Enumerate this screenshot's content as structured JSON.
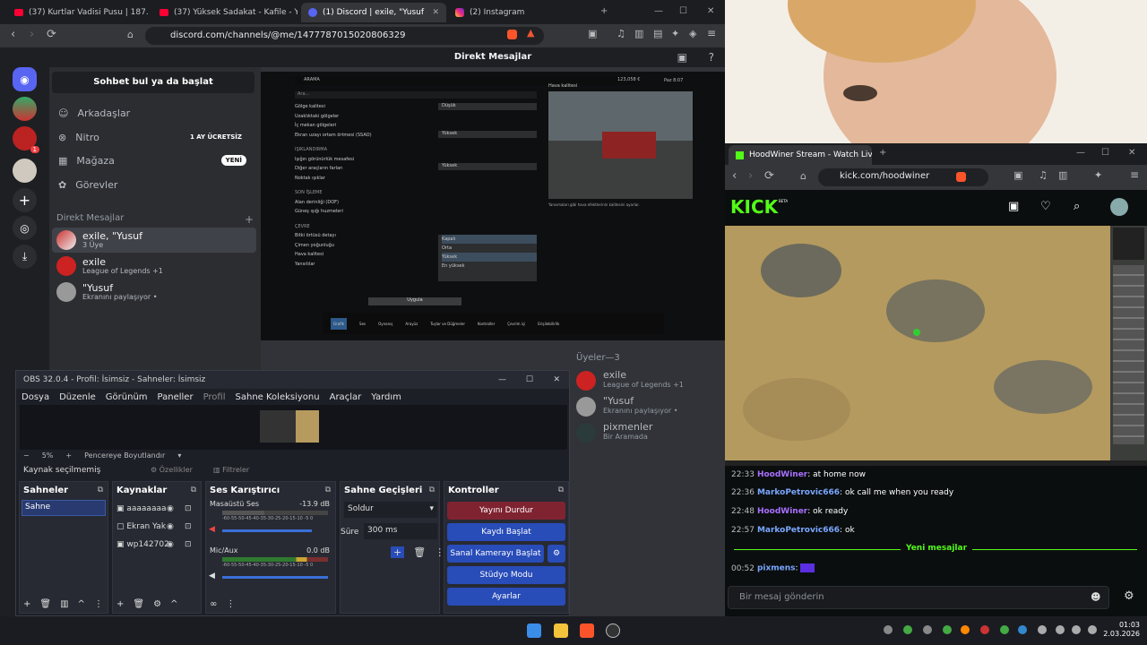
{
  "left_browser": {
    "tabs": [
      {
        "label": "(37) Kurtlar Vadisi Pusu | 187. Bölüm",
        "icon": "youtube-icon"
      },
      {
        "label": "(37) Yüksek Sadakat - Kafile - Yo",
        "icon": "youtube-icon"
      },
      {
        "label": "(1) Discord | exile, \"Yusuf",
        "icon": "discord-icon",
        "active": true
      },
      {
        "label": "(2) Instagram",
        "icon": "instagram-icon"
      }
    ],
    "url": "discord.com/channels/@me/1477787015020806329"
  },
  "discord": {
    "title": "Direkt Mesajlar",
    "search_label": "Sohbet bul ya da başlat",
    "nav": [
      {
        "label": "Arkadaşlar",
        "icon": "friends-icon"
      },
      {
        "label": "Nitro",
        "icon": "nitro-icon",
        "badge": "1 AY ÜCRETSİZ"
      },
      {
        "label": "Mağaza",
        "icon": "shop-icon",
        "badge": "YENİ"
      },
      {
        "label": "Görevler",
        "icon": "quests-icon"
      }
    ],
    "dm_header": "Direkt Mesajlar",
    "dms": [
      {
        "name": "exile, \"Yusuf",
        "sub": "3 Üye"
      },
      {
        "name": "exile",
        "sub": "League of Legends +1"
      },
      {
        "name": "\"Yusuf",
        "sub": "Ekranını paylaşıyor •"
      }
    ],
    "members_title": "Üyeler—3",
    "members": [
      {
        "name": "exile",
        "sub": "League of Legends +1"
      },
      {
        "name": "\"Yusuf",
        "sub": "Ekranını paylaşıyor •"
      },
      {
        "name": "pixmenler",
        "sub": "Bir Aramada"
      }
    ],
    "rail_badge": "1"
  },
  "game_settings": {
    "rows_a": [
      "Gölge kalitesi",
      "Uzaklıktaki gölgeler",
      "İç mekan gölgeleri",
      "Ekran uzayı ortam örtmesi (SSAO)"
    ],
    "values_a": [
      "Düşük",
      "",
      "",
      "Yüksek"
    ],
    "sec_b": "IŞIKLANDIRMA",
    "rows_b": [
      "Işığın görünürlük mesafesi",
      "Diğer araçların farları",
      "Noktalı ışıklar"
    ],
    "values_b": [
      "Yüksek",
      "",
      ""
    ],
    "sec_c": "SON İŞLEME",
    "rows_c": [
      "Alan derinliği (DOF)",
      "Güneş ışığı huzmeleri"
    ],
    "sec_d": "ÇEVRE",
    "rows_d": [
      "Bitki örtüsü detayı",
      "Çimen yoğunluğu",
      "Hava kalitesi",
      "Yansıtılar"
    ],
    "dropdown_options": [
      "Kapalı",
      "Orta",
      "Yüksek",
      "En yüksek"
    ],
    "weather_label": "Hava kalitesi",
    "hint": "Yansımaları gibi hava efektlerinin kalitesini ayarlar.",
    "apply": "Uygula",
    "money": "123,058 €",
    "time": "Paz 8:07",
    "search": "Ara...",
    "tab_label": "ARAMA",
    "bottom_tabs": [
      "Grafik",
      "Ses",
      "Oynanış",
      "Arayüz",
      "Tuşlar ve Düğmeler",
      "Kontroller",
      "Çevrim içi",
      "Erişilebilirlik"
    ]
  },
  "obs": {
    "title": "OBS 32.0.4 - Profil: İsimsiz - Sahneler: İsimsiz",
    "menu": [
      "Dosya",
      "Düzenle",
      "Görünüm",
      "Paneller",
      "Profil",
      "Sahne Koleksiyonu",
      "Araçlar",
      "Yardım"
    ],
    "zoom": "5%",
    "fit": "Pencereye Boyutlandır",
    "no_source": "Kaynak seçilmemiş",
    "properties": "Özellikler",
    "filters": "Filtreler",
    "scenes_title": "Sahneler",
    "scene": "Sahne",
    "sources_title": "Kaynaklar",
    "sources": [
      "aaaaaaaa",
      "Ekran Yak",
      "wp142702"
    ],
    "mixer_title": "Ses Karıştırıcı",
    "mixer": [
      {
        "name": "Masaüstü Ses",
        "db": "-13.9 dB"
      },
      {
        "name": "Mic/Aux",
        "db": "0.0 dB"
      }
    ],
    "meter_scale": "-60-55-50-45-40-35-30-25-20-15-10 -5 0",
    "transitions_title": "Sahne Geçişleri",
    "transition": "Soldur",
    "duration_label": "Süre",
    "duration": "300 ms",
    "controls_title": "Kontroller",
    "controls": [
      "Yayını Durdur",
      "Kaydı Başlat",
      "Sanal Kamerayı Başlat",
      "Stüdyo Modu",
      "Ayarlar"
    ]
  },
  "kick": {
    "tab": "HoodWiner Stream - Watch Live",
    "url": "kick.com/hoodwiner",
    "logo": "KICK",
    "logo_tag": "BETA",
    "chat": [
      {
        "time": "22:33",
        "user": "HoodWiner",
        "msg": "at home now"
      },
      {
        "time": "22:36",
        "user": "MarkoPetrovic666",
        "msg": "ok call me when you ready"
      },
      {
        "time": "22:48",
        "user": "HoodWiner",
        "msg": "ok ready"
      },
      {
        "time": "22:57",
        "user": "MarkoPetrovic666",
        "msg": "ok"
      }
    ],
    "new_messages": "Yeni mesajlar",
    "last": {
      "time": "00:52",
      "user": "pixmens"
    },
    "input_placeholder": "Bir mesaj gönderin"
  },
  "taskbar": {
    "time": "01:03",
    "date": "2.03.2026"
  },
  "colors": {
    "discord": "#5865f2",
    "kick": "#53fc18",
    "obs_red": "#7f2331",
    "obs_blue": "#284cb8"
  }
}
